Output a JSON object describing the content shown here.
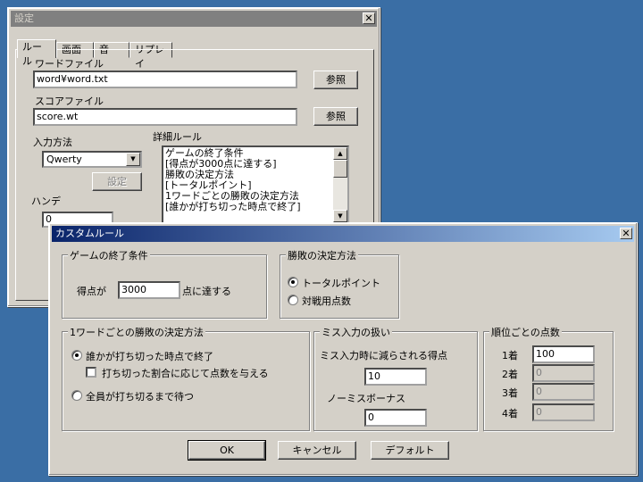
{
  "settings_window": {
    "title": "設定",
    "close": "✕",
    "tabs": [
      "ルール",
      "画面",
      "音",
      "リプレイ"
    ],
    "word_file_label": "ワードファイル",
    "word_file_value": "word¥word.txt",
    "browse_label": "参照",
    "score_file_label": "スコアファイル",
    "score_file_value": "score.wt",
    "input_method_label": "入力方法",
    "input_method_value": "Qwerty",
    "settings_button": "設定",
    "handicap_label": "ハンデ",
    "handicap_value": "0",
    "detail_rules_label": "詳細ルール",
    "detail_rules_lines": [
      "ゲームの終了条件",
      "[得点が3000点に達する]",
      "勝敗の決定方法",
      "[トータルポイント]",
      "1ワードごとの勝敗の決定方法",
      "[誰かが打ち切った時点で終了]"
    ]
  },
  "custom_rule_dialog": {
    "title": "カスタムルール",
    "close": "✕",
    "end_condition": {
      "title": "ゲームの終了条件",
      "prefix": "得点が",
      "value": "3000",
      "suffix": "点に達する"
    },
    "winner_method": {
      "title": "勝敗の決定方法",
      "options": [
        "トータルポイント",
        "対戦用点数"
      ],
      "selected": 0
    },
    "per_word": {
      "title": "1ワードごとの勝敗の決定方法",
      "option1": "誰かが打ち切った時点で終了",
      "checkbox": "打ち切った割合に応じて点数を与える",
      "option2": "全員が打ち切るまで待つ"
    },
    "miss": {
      "title": "ミス入力の扱い",
      "penalty_label": "ミス入力時に減らされる得点",
      "penalty_value": "10",
      "bonus_label": "ノーミスボーナス",
      "bonus_value": "0"
    },
    "rank_points": {
      "title": "順位ごとの点数",
      "ranks": [
        {
          "label": "1着",
          "value": "100"
        },
        {
          "label": "2着",
          "value": "0"
        },
        {
          "label": "3着",
          "value": "0"
        },
        {
          "label": "4着",
          "value": "0"
        }
      ]
    },
    "buttons": {
      "ok": "OK",
      "cancel": "キャンセル",
      "default": "デフォルト"
    }
  }
}
